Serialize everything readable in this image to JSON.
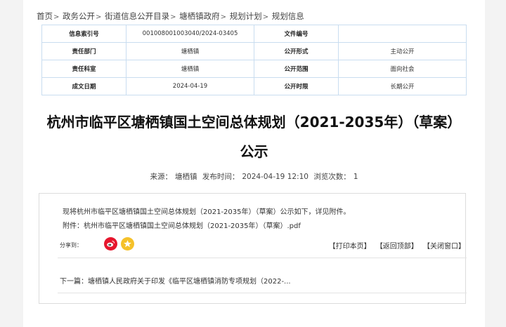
{
  "breadcrumb": {
    "items": [
      "首页",
      "政务公开",
      "街道信息公开目录",
      "塘栖镇政府",
      "规划计划",
      "规划信息"
    ],
    "separator": ">"
  },
  "meta": {
    "rows": [
      {
        "l1": "信息索引号",
        "v1": "001008001003040/2024-03405",
        "l2": "文件编号",
        "v2": ""
      },
      {
        "l1": "责任部门",
        "v1": "塘栖镇",
        "l2": "公开形式",
        "v2": "主动公开"
      },
      {
        "l1": "责任科室",
        "v1": "塘栖镇",
        "l2": "公开范围",
        "v2": "面向社会"
      },
      {
        "l1": "成文日期",
        "v1": "2024-04-19",
        "l2": "公开时限",
        "v2": "长期公开"
      }
    ]
  },
  "article": {
    "title_line1": "杭州市临平区塘栖镇国土空间总体规划（2021-2035年）（草案）",
    "title_line2": "公示",
    "source_label": "来源：",
    "source_value": "塘栖镇",
    "publish_label": "发布时间：",
    "publish_value": "2024-04-19 12:10",
    "views_label": "浏览次数：",
    "views_value": "1",
    "body": "现将杭州市临平区塘栖镇国土空间总体规划（2021-2035年）（草案）公示如下，详见附件。",
    "attachment_label": "附件：",
    "attachment_link": "杭州市临平区塘栖镇国土空间总体规划（2021-2035年）（草案）.pdf"
  },
  "share": {
    "label": "分享到：",
    "icons": [
      "weibo-icon",
      "qzone-icon"
    ],
    "colors": {
      "weibo": "#e6162d",
      "qzone": "#f5c12a"
    }
  },
  "actions": {
    "print": "【打印本页】",
    "top": "【返回顶部】",
    "close": "【关闭窗口】"
  },
  "next": {
    "label": "下一篇：",
    "link": "塘栖镇人民政府关于印发《临平区塘栖镇消防专项规划（2022-..."
  },
  "colors": {
    "table_border": "#c9ddf0",
    "page_bg": "#f3f3f3"
  }
}
